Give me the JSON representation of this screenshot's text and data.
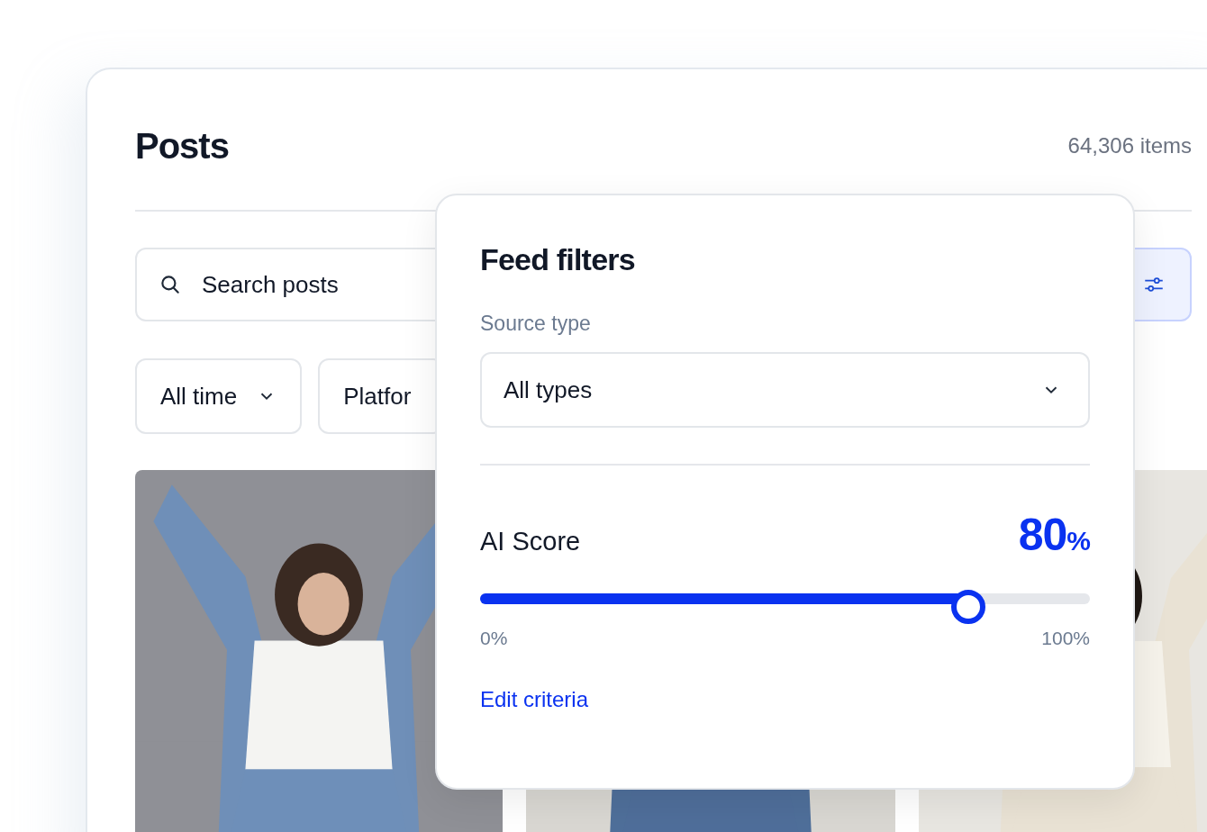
{
  "header": {
    "title": "Posts",
    "count": "64,306 items"
  },
  "search": {
    "placeholder": "Search posts"
  },
  "filter_chips": [
    {
      "label": "All time",
      "chevron": true
    },
    {
      "label": "Platfor",
      "chevron": false
    }
  ],
  "popover": {
    "title": "Feed filters",
    "source_label": "Source type",
    "source_value": "All types",
    "score_label": "AI Score",
    "score_value": "80",
    "score_unit": "%",
    "slider": {
      "level": 0.8,
      "min_label": "0%",
      "max_label": "100%"
    },
    "link": "Edit criteria"
  }
}
